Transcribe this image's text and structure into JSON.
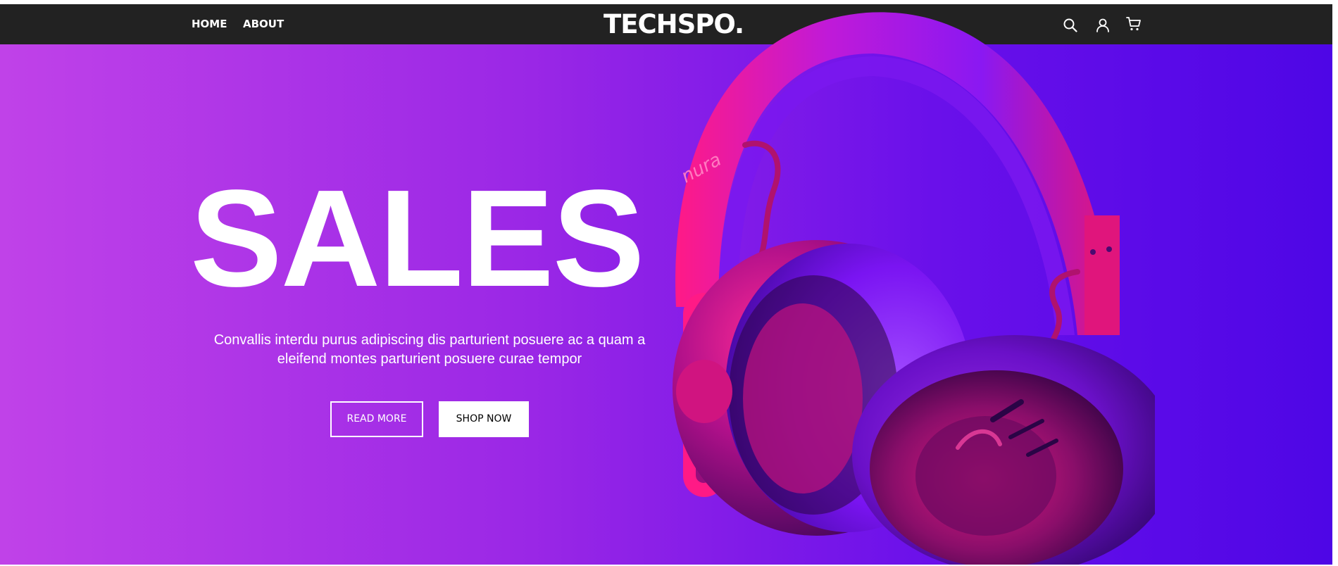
{
  "nav": {
    "home_label": "HOME",
    "about_label": "ABOUT",
    "logo_text": "TECHSPO.",
    "icons": [
      "search-icon",
      "user-icon",
      "cart-icon"
    ]
  },
  "hero": {
    "title": "SALES",
    "description": "Convallis interdu purus adipiscing dis parturient posuere ac a quam a eleifend montes parturient posuere curae tempor",
    "read_more_label": "READ MORE",
    "shop_now_label": "SHOP NOW",
    "product_brand": "nura",
    "colors": {
      "navbar": "#222222",
      "gradient_start": "#c042e8",
      "gradient_end": "#4e06e6",
      "headphone_pink": "#ff1a86",
      "headphone_purple": "#7a10f0"
    }
  }
}
